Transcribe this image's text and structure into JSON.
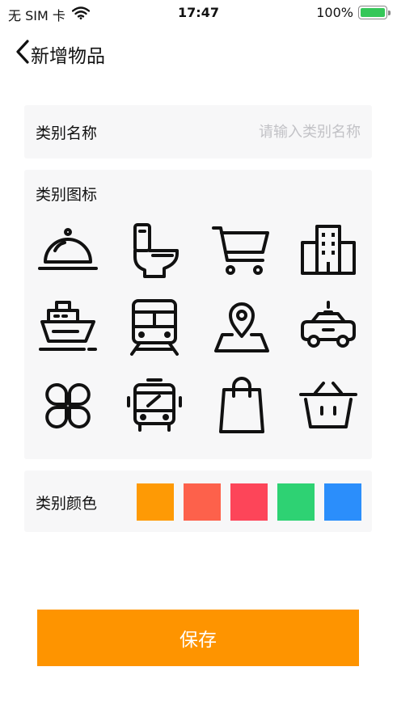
{
  "status_bar": {
    "carrier": "无 SIM 卡",
    "time": "17:47",
    "battery_percent_text": "100%",
    "battery_level": 1.0,
    "wifi_icon": "wifi-icon",
    "battery_icon": "battery-icon"
  },
  "nav": {
    "back_icon": "chevron-left-icon",
    "title": "新增物品"
  },
  "form": {
    "name_label": "类别名称",
    "name_value": "",
    "name_placeholder": "请输入类别名称",
    "icon_label": "类别图标",
    "icons": [
      "food-cloche-icon",
      "toilet-icon",
      "shopping-cart-icon",
      "building-icon",
      "ship-icon",
      "train-icon",
      "location-pin-icon",
      "taxi-icon",
      "clover-icon",
      "bus-icon",
      "shopping-bag-icon",
      "basket-icon"
    ],
    "color_label": "类别颜色",
    "colors": [
      "#fe9a05",
      "#fd614b",
      "#fd4559",
      "#2ed273",
      "#2b8efb"
    ]
  },
  "actions": {
    "save_label": "保存"
  },
  "theme": {
    "accent": "#fe9400",
    "card_bg": "#f7f7f8",
    "icon_stroke": "#111111"
  }
}
